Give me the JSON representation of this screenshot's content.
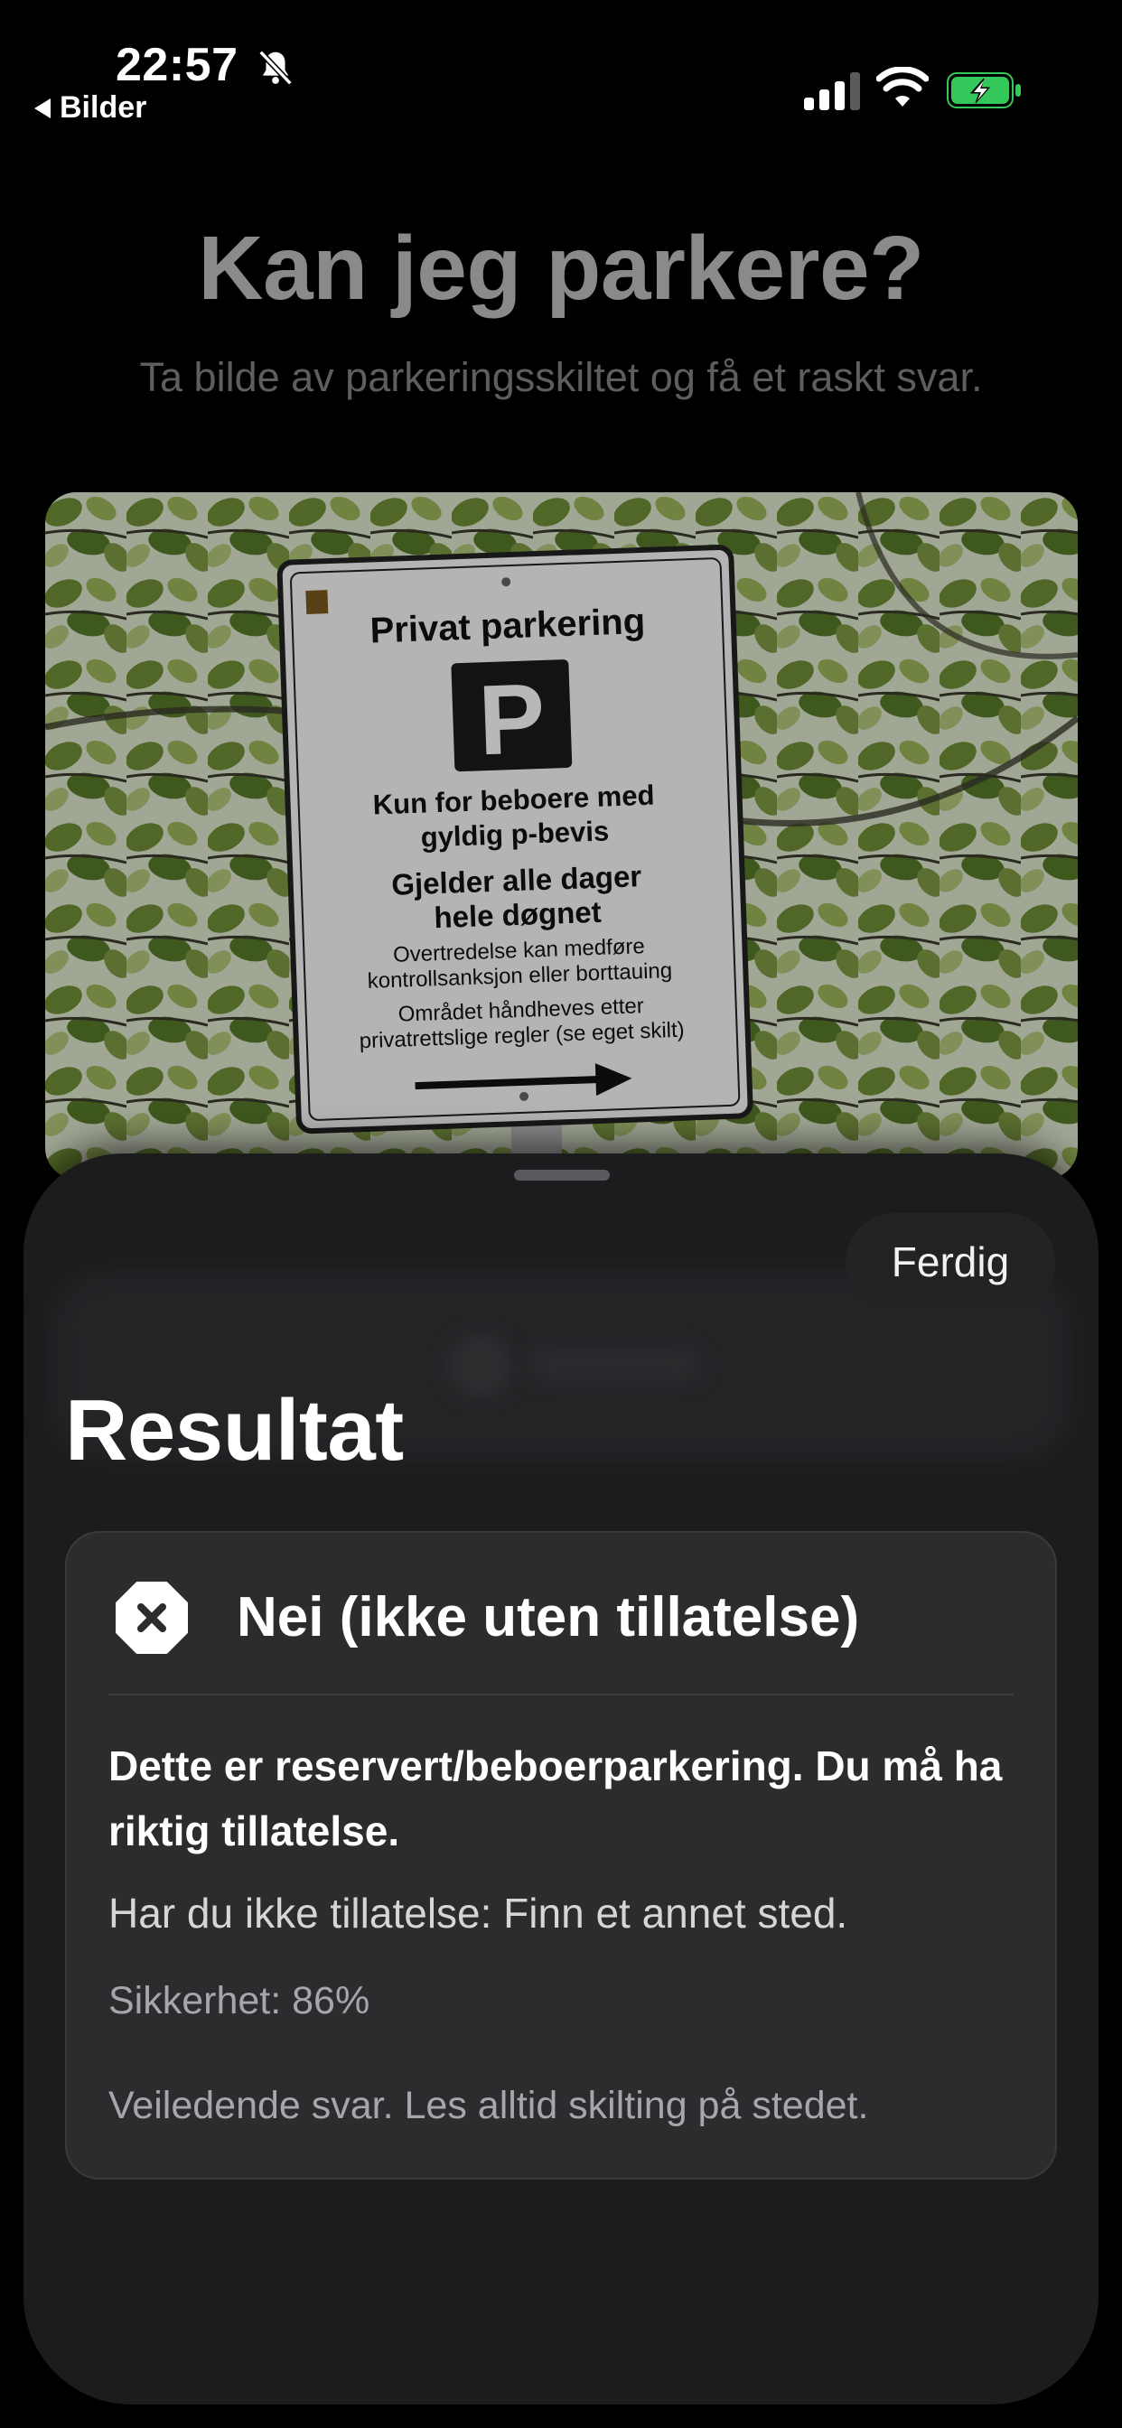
{
  "status_bar": {
    "time": "22:57",
    "back_label": "Bilder",
    "icons": [
      "bell-slash-icon",
      "cellular-signal-icon",
      "wifi-icon",
      "battery-charging-icon"
    ]
  },
  "header": {
    "title": "Kan jeg parkere?",
    "subtitle": "Ta bilde av parkeringsskiltet og få et raskt svar."
  },
  "photo": {
    "sign": {
      "heading": "Privat parkering",
      "symbol": "P",
      "line1": "Kun for beboere med",
      "line2": "gyldig p-bevis",
      "line3": "Gjelder alle dager",
      "line4": "hele døgnet",
      "line5": "Overtredelse kan medføre",
      "line6": "kontrollsanksjon eller borttauing",
      "line7": "Området håndheves etter",
      "line8": "privatrettslige regler (se eget skilt)"
    }
  },
  "sheet": {
    "done_label": "Ferdig",
    "title": "Resultat",
    "result": {
      "verdict": "Nei (ikke uten tillatelse)",
      "verdict_icon": "x-octagon-icon",
      "reason": "Dette er reservert/beboerparkering. Du må ha riktig tillatelse.",
      "advice": "Har du ikke tillatelse: Finn et annet sted.",
      "confidence": "Sikkerhet: 86%",
      "disclaimer": "Veiledende svar. Les alltid skilting på stedet."
    }
  },
  "colors": {
    "background": "#000000",
    "sheet": "#1c1c1e",
    "card": "#2c2c2e",
    "battery_green": "#34c759"
  }
}
